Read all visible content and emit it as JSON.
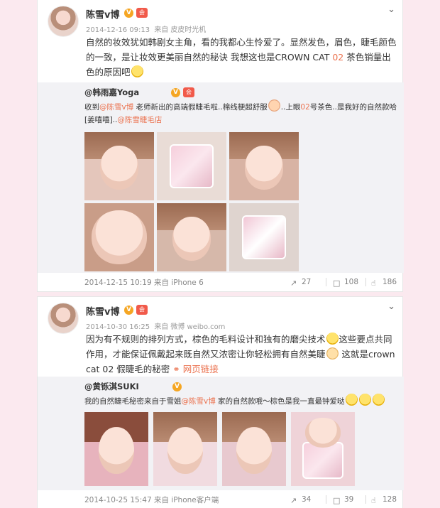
{
  "posts": [
    {
      "username": "陈雪v博",
      "timestamp": "2014-12-16 09:13",
      "source_prefix": "来自",
      "source": "皮皮时光机",
      "text_before": "自然的妆效犹如韩剧女主角，看的我都心生怜爱了。显然发色，眉色，睫毛颜色的一致，是让妆效更美丽自然的秘诀 我想这也是CROWN CAT ",
      "text_highlight": "02",
      "text_after": " 茶色销量出色的原因吧",
      "repost": {
        "username": "@韩雨嘉Yoga",
        "text_pre": "收到",
        "mention1": "@陈雪v博",
        "text_mid": " 老师新出的高端假睫毛啦..棉线梗超舒服",
        "text_mid2": "..上眼",
        "highlight": "02",
        "text_post": "号茶色..是我好的自然款哈[姜嘻嘻]..",
        "mention2": "@陈雪睫毛店",
        "footer_time": "2014-12-15 10:19",
        "footer_source_prefix": "来自",
        "footer_source": "iPhone 6",
        "reposts": "27",
        "comments": "108",
        "likes": "186"
      }
    },
    {
      "username": "陈雪v博",
      "timestamp": "2014-10-30 16:25",
      "source_prefix": "来自",
      "source": "微博 weibo.com",
      "text_before": "因为有不规则的排列方式，棕色的毛料设计和独有的磨尖技术",
      "text_after": "这些要点共同作用，才能保证佩戴起来既自然又浓密让你轻松拥有自然美睫",
      "text_tail": " 这就是crown cat 02 假睫毛的秘密",
      "link_label": "网页链接",
      "repost": {
        "username": "@黄铄淇SUKI",
        "text_pre": "我的自然睫毛秘密来自于雪姐",
        "mention1": "@陈雪v博",
        "text_post": " 家的自然款哦～棕色是我一直最钟爱哒",
        "footer_time": "2014-10-25 15:47",
        "footer_source_prefix": "来自",
        "footer_source": "iPhone客户端",
        "reposts": "34",
        "comments": "39",
        "likes": "128"
      }
    }
  ],
  "icons": {
    "chevron": "chevron-down-icon",
    "verified": "verified-badge-icon",
    "repost": "repost-icon",
    "comment": "comment-icon",
    "like": "like-icon",
    "link": "link-icon"
  },
  "badges": {
    "verified_glyph": "V",
    "rank_glyph": "会"
  },
  "colors": {
    "accent": "#eb7350",
    "background": "#fbe9ef",
    "repost_bg": "#f2f2f5"
  }
}
